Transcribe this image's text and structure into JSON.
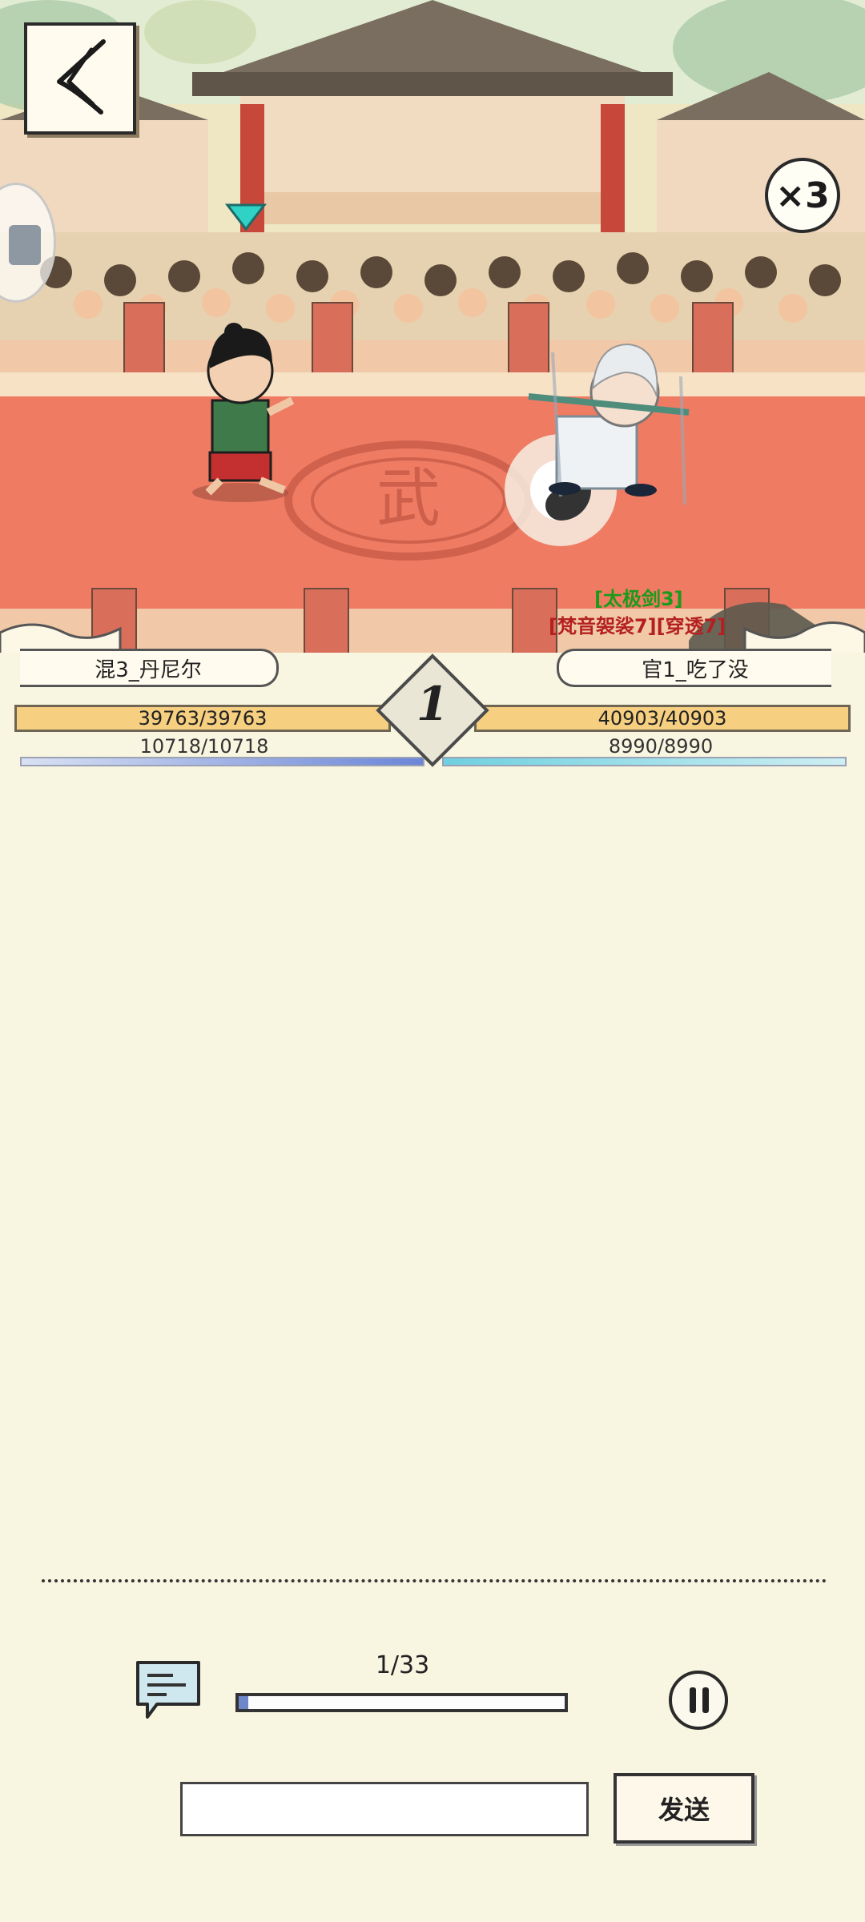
{
  "battle": {
    "speed_multiplier": "×3",
    "round": "1",
    "player": {
      "name": "混3_丹尼尔",
      "hp_text": "39763/39763",
      "hp_fraction": 1.0,
      "mp_text": "10718/10718",
      "mp_fraction": 1.0
    },
    "opponent": {
      "name": "官1_吃了没",
      "hp_text": "40903/40903",
      "hp_fraction": 1.0,
      "mp_text": "8990/8990",
      "mp_fraction": 1.0,
      "skill_tags": [
        "[太极剑3]",
        "[梵音袈裟7][穿透7]"
      ]
    },
    "arena_emblem": "武"
  },
  "controls": {
    "progress_text": "1/33",
    "progress_fraction": 0.0303,
    "message_placeholder": "",
    "send_label": "发送"
  },
  "icons": {
    "back": "back-arrow-icon",
    "chat": "chat-bubble-icon",
    "pause": "pause-icon",
    "speed": "speed-badge-icon"
  },
  "colors": {
    "hp_bar": "#f6cf80",
    "player_mp": "#6b86d8",
    "opponent_mp": "#6fd0e0",
    "arena_floor": "#ef7b63",
    "skill_green": "#1a9b1a",
    "skill_red": "#b42020",
    "indicator": "#2fd2c4"
  }
}
